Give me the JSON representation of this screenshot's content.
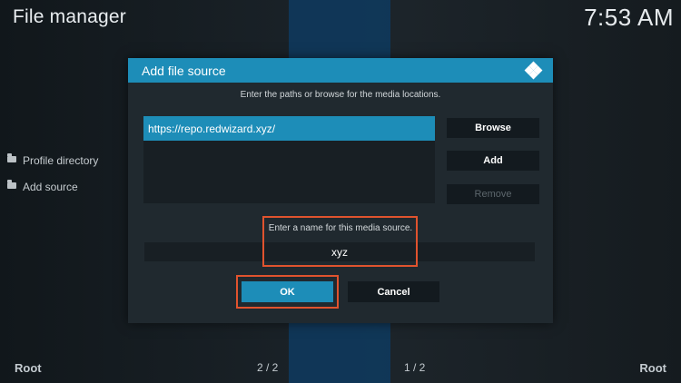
{
  "app": {
    "title": "File manager",
    "clock": "7:53 AM"
  },
  "sidebar": {
    "items": [
      {
        "label": "Profile directory",
        "icon": "folder-icon"
      },
      {
        "label": "Add source",
        "icon": "folder-icon"
      }
    ]
  },
  "footer": {
    "left_label": "Root",
    "right_label": "Root",
    "left_page": "2 / 2",
    "right_page": "1 / 2"
  },
  "dialog": {
    "title": "Add file source",
    "icon": "kodi-logo-icon",
    "instruction": "Enter the paths or browse for the media locations.",
    "paths": [
      "https://repo.redwizard.xyz/"
    ],
    "buttons": {
      "browse": "Browse",
      "add": "Add",
      "remove": "Remove"
    },
    "name_prompt": "Enter a name for this media source.",
    "name_value": "xyz",
    "ok": "OK",
    "cancel": "Cancel"
  },
  "colors": {
    "accent": "#1d8db8",
    "highlight": "#e0532e",
    "background": "#171d21",
    "dialog_bg": "#20292f"
  }
}
